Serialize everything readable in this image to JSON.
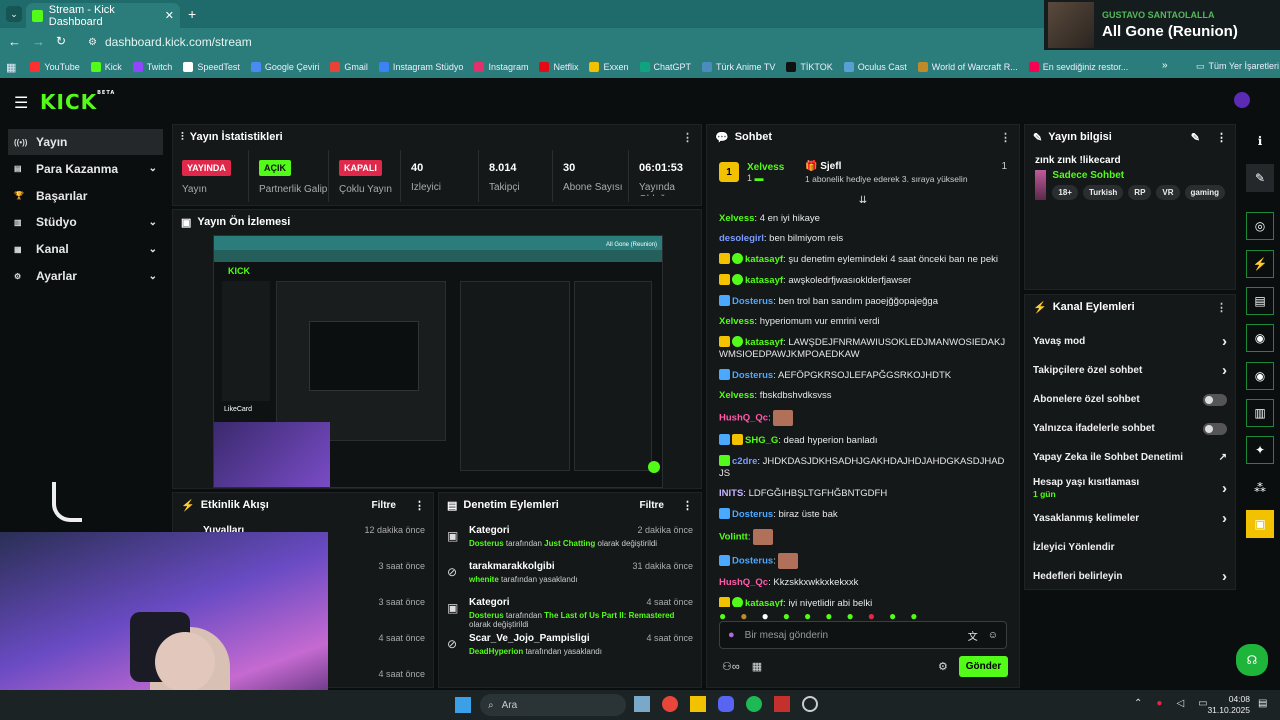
{
  "browser": {
    "tab_title": "Stream - Kick Dashboard",
    "url": "dashboard.kick.com/stream",
    "bookmarks": [
      {
        "label": "YouTube",
        "color": "#ff3030"
      },
      {
        "label": "Kick",
        "color": "#53fc18"
      },
      {
        "label": "Twitch",
        "color": "#9146ff"
      },
      {
        "label": "SpeedTest",
        "color": "#ffffff"
      },
      {
        "label": "Google Çeviri",
        "color": "#4a8af4"
      },
      {
        "label": "Gmail",
        "color": "#ea4335"
      },
      {
        "label": "Instagram Stüdyo",
        "color": "#3b82f6"
      },
      {
        "label": "Instagram",
        "color": "#e1306c"
      },
      {
        "label": "Netflix",
        "color": "#e50914"
      },
      {
        "label": "Exxen",
        "color": "#f2c200"
      },
      {
        "label": "ChatGPT",
        "color": "#10a37f"
      },
      {
        "label": "Türk Anime TV",
        "color": "#4b8bbe"
      },
      {
        "label": "TİKTOK",
        "color": "#111111"
      },
      {
        "label": "Oculus Cast",
        "color": "#5a9fd4"
      },
      {
        "label": "World of Warcraft R...",
        "color": "#c08a2a"
      },
      {
        "label": "En sevdiğiniz restor...",
        "color": "#fa0050"
      }
    ],
    "all_bookmarks": "Tüm Yer İşaretleri"
  },
  "media": {
    "artist": "GUSTAVO SANTAOLALLA",
    "track": "All Gone (Reunion)"
  },
  "kick": {
    "logo": "KICK",
    "logo_badge": "BETA"
  },
  "sidebar": [
    {
      "label": "Yayın",
      "icon": "broadcast-icon",
      "active": true
    },
    {
      "label": "Para Kazanma",
      "icon": "money-icon",
      "chev": "⌄"
    },
    {
      "label": "Başarılar",
      "icon": "trophy-icon"
    },
    {
      "label": "Stüdyo",
      "icon": "studio-icon",
      "chev": "⌄"
    },
    {
      "label": "Kanal",
      "icon": "channel-icon",
      "chev": "⌄"
    },
    {
      "label": "Ayarlar",
      "icon": "settings-icon",
      "chev": "⌄"
    }
  ],
  "stats": {
    "title": "Yayın İstatistikleri",
    "items": [
      {
        "badge": "YAYINDA",
        "label": "Yayın",
        "color": "#e0284a",
        "textcolor": "#fff"
      },
      {
        "badge": "AÇIK",
        "label": "Partnerlik Galip",
        "color": "#53fc18",
        "textcolor": "#0b0e0f"
      },
      {
        "badge": "KAPALI",
        "label": "Çoklu Yayın",
        "color": "#e0284a",
        "textcolor": "#fff"
      },
      {
        "value": "40",
        "label": "İzleyici"
      },
      {
        "value": "8.014",
        "label": "Takipçi"
      },
      {
        "value": "30",
        "label": "Abone Sayısı"
      },
      {
        "value": "06:01:53",
        "label": "Yayında Olduğu"
      }
    ]
  },
  "preview": {
    "title": "Yayın Ön İzlemesi",
    "inner_title": "All Gone (Reunion)",
    "inner_brand": "LikeCard"
  },
  "activity": {
    "title": "Etkinlik Akışı",
    "filter": "Filtre",
    "items": [
      {
        "label": "Yuvalları",
        "time": "12 dakika önce"
      },
      {
        "label": "",
        "time": "3 saat önce"
      },
      {
        "label": "",
        "time": "3 saat önce"
      },
      {
        "label": "",
        "time": "4 saat önce"
      },
      {
        "label": "",
        "time": "4 saat önce"
      }
    ]
  },
  "moderation": {
    "title": "Denetim Eylemleri",
    "filter": "Filtre",
    "items": [
      {
        "icon": "category-icon",
        "title": "Kategori",
        "user": "Dosterus",
        "mid": " tarafından ",
        "target": "Just Chatting",
        "tail": " olarak değiştirildi",
        "time": "2 dakika önce"
      },
      {
        "icon": "ban-icon",
        "title": "tarakmarakkolgibi",
        "user": "whenite",
        "mid": " tarafından yasaklandı",
        "target": "",
        "tail": "",
        "time": "31 dakika önce"
      },
      {
        "icon": "category-icon",
        "title": "Kategori",
        "user": "Dosterus",
        "mid": " tarafından ",
        "target": "The Last of Us Part II: Remastered",
        "tail": " olarak değiştirildi",
        "time": "4 saat önce"
      },
      {
        "icon": "ban-icon",
        "title": "Scar_Ve_Jojo_Pampisligi",
        "user": "DeadHyperion",
        "mid": " tarafından yasaklandı",
        "target": "",
        "tail": "",
        "time": "4 saat önce"
      }
    ]
  },
  "chat": {
    "title": "Sohbet",
    "pinned": {
      "rank": "1",
      "user": "Xelvess",
      "user_count": "1",
      "gifter": "Sjefl",
      "gift_count": "1",
      "gift_text": "1 abonelik hediye ederek 3. sıraya yükselin"
    },
    "messages": [
      {
        "user": "Xelvess",
        "color": "#53fc18",
        "badges": [],
        "text": "4 en iyi hikaye"
      },
      {
        "user": "desolegirl",
        "color": "#7b9cff",
        "badges": [],
        "text": "ben bilmiyom reis"
      },
      {
        "user": "katasayf",
        "color": "#53fc18",
        "badges": [
          "crown",
          "verified"
        ],
        "text": "şu denetim eylemindeki 4 saat önceki ban ne peki"
      },
      {
        "user": "katasayf",
        "color": "#53fc18",
        "badges": [
          "crown",
          "verified"
        ],
        "text": "awşkoledrfjwasıoklderfjawser"
      },
      {
        "user": "Dosterus",
        "color": "#4aa8ff",
        "badges": [
          "mod"
        ],
        "text": "ben trol ban sandım paoejğğopajeğga"
      },
      {
        "user": "Xelvess",
        "color": "#53fc18",
        "badges": [],
        "text": "hyperiomum vur emrini verdi"
      },
      {
        "user": "katasayf",
        "color": "#53fc18",
        "badges": [
          "crown",
          "verified"
        ],
        "text": "LAWŞDEJFNRMAWIUSOKLEDJMANWOSIEDAKJWMSIOEDPAWJKMPOAEDKAW"
      },
      {
        "user": "Dosterus",
        "color": "#4aa8ff",
        "badges": [
          "mod"
        ],
        "text": "AEFÖPGKRSOJLEFAPĞGSRKOJHDTK"
      },
      {
        "user": "Xelvess",
        "color": "#53fc18",
        "badges": [],
        "text": "fbskdbshvdksvss"
      },
      {
        "user": "HushQ_Qc",
        "color": "#ff5aa8",
        "badges": [],
        "text": "",
        "emote": true
      },
      {
        "user": "SHG_G",
        "color": "#53fc18",
        "badges": [
          "mod",
          "crown"
        ],
        "text": "dead hyperion banladı"
      },
      {
        "user": "c2dre",
        "color": "#7b9cff",
        "badges": [
          "sub"
        ],
        "text": "JHDKDASJDKHSADHJGAKHDAJHDJAHDGKASDJHADJS"
      },
      {
        "user": "INITS",
        "color": "#c6b6ff",
        "badges": [],
        "text": "LDFGĞIHBŞLTGFHĞBNTGDFH"
      },
      {
        "user": "Dosterus",
        "color": "#4aa8ff",
        "badges": [
          "mod"
        ],
        "text": "biraz üste bak"
      },
      {
        "user": "Volintt",
        "color": "#53fc18",
        "badges": [],
        "text": "",
        "emote": true
      },
      {
        "user": "Dosterus",
        "color": "#4aa8ff",
        "badges": [
          "mod"
        ],
        "text": "",
        "emote": true
      },
      {
        "user": "HushQ_Qc",
        "color": "#ff5aa8",
        "badges": [],
        "text": "Kkzskkxwkkxkekxxk"
      },
      {
        "user": "katasayf",
        "color": "#53fc18",
        "badges": [
          "crown",
          "verified"
        ],
        "text": "iyi niyetlidir abi belki"
      }
    ],
    "input_placeholder": "Bir mesaj gönderin",
    "send_label": "Gönder"
  },
  "stream_info": {
    "title": "Yayın bilgisi",
    "stream_title": "zınk zınk !likecard",
    "category": "Sadece Sohbet",
    "tags": [
      "18+",
      "Turkish",
      "RP",
      "VR",
      "gaming"
    ]
  },
  "channel_actions": {
    "title": "Kanal Eylemleri",
    "items": [
      {
        "label": "Yavaş mod",
        "control": "chevron"
      },
      {
        "label": "Takipçilere özel sohbet",
        "control": "chevron"
      },
      {
        "label": "Abonelere özel sohbet",
        "control": "toggle"
      },
      {
        "label": "Yalnızca ifadelerle sohbet",
        "control": "toggle"
      },
      {
        "label": "Yapay Zeka ile Sohbet Denetimi",
        "control": "external"
      },
      {
        "label": "Hesap yaşı kısıtlaması",
        "sub": "1 gün",
        "control": "chevron"
      },
      {
        "label": "Yasaklanmış kelimeler",
        "control": "chevron"
      },
      {
        "label": "İzleyici Yönlendir",
        "control": "none"
      },
      {
        "label": "Hedefleri belirleyin",
        "control": "chevron"
      }
    ]
  },
  "taskbar": {
    "search": "Ara",
    "time": "04:08",
    "date": "31.10.2025"
  }
}
